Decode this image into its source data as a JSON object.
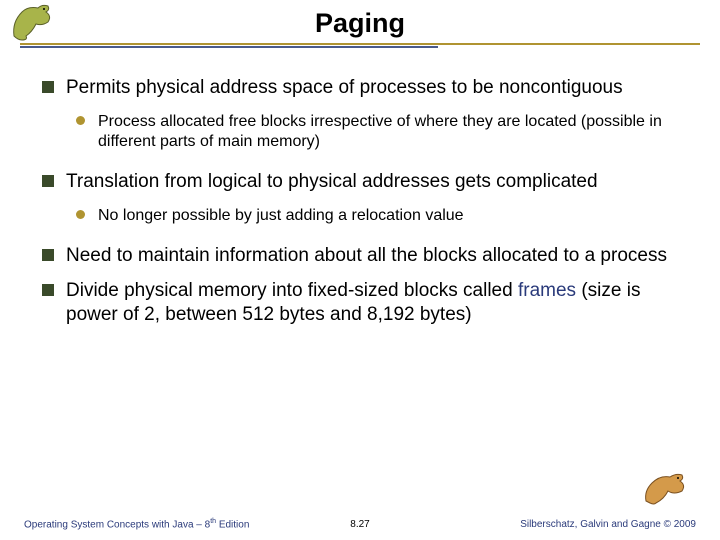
{
  "title": "Paging",
  "bullets": [
    {
      "text": "Permits physical address space of processes to be noncontiguous",
      "sub": [
        "Process allocated free blocks irrespective of where they are located (possible in different parts of main memory)"
      ]
    },
    {
      "text": "Translation from logical to physical addresses gets complicated",
      "sub": [
        "No longer possible by just adding a relocation value"
      ]
    },
    {
      "text": "Need to maintain information about all the blocks allocated to a process",
      "sub": []
    },
    {
      "html": "Divide physical memory into fixed-sized blocks called <span class=\"kw\">frames</span> (size is power of 2, between 512 bytes and 8,192 bytes)",
      "sub": []
    }
  ],
  "footer": {
    "left_a": "Operating System Concepts with Java – 8",
    "left_b": " Edition",
    "left_sup": "th",
    "mid": "8.27",
    "right": "Silberschatz, Galvin and Gagne © 2009"
  }
}
